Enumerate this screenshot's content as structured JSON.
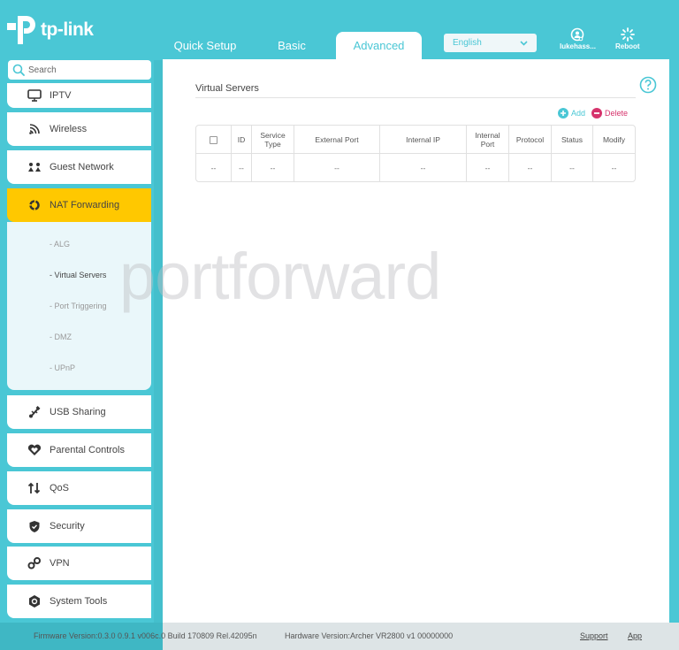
{
  "brand": {
    "name": "tp-link",
    "accent": "#4ac7d5",
    "highlight": "#ffc800",
    "danger": "#d6336c"
  },
  "header": {
    "tabs": [
      {
        "label": "Quick Setup",
        "active": false
      },
      {
        "label": "Basic",
        "active": false
      },
      {
        "label": "Advanced",
        "active": true
      }
    ],
    "language": {
      "selected": "English"
    },
    "user": {
      "label": "lukehass...",
      "icon": "user-icon"
    },
    "reboot": {
      "label": "Reboot",
      "icon": "reboot-icon"
    }
  },
  "sidebar": {
    "search_placeholder": "Search",
    "items": [
      {
        "label": "IPTV",
        "icon": "tv-icon"
      },
      {
        "label": "Wireless",
        "icon": "wireless-icon"
      },
      {
        "label": "Guest Network",
        "icon": "guest-network-icon"
      },
      {
        "label": "NAT Forwarding",
        "icon": "nat-forwarding-icon",
        "active": true
      },
      {
        "label": "USB Sharing",
        "icon": "usb-icon"
      },
      {
        "label": "Parental Controls",
        "icon": "heart-icon"
      },
      {
        "label": "QoS",
        "icon": "qos-arrows-icon"
      },
      {
        "label": "Security",
        "icon": "shield-icon"
      },
      {
        "label": "VPN",
        "icon": "vpn-link-icon"
      },
      {
        "label": "System Tools",
        "icon": "gear-icon"
      }
    ],
    "subitems": [
      {
        "label": "- ALG"
      },
      {
        "label": "- Virtual Servers",
        "active": true
      },
      {
        "label": "- Port Triggering"
      },
      {
        "label": "- DMZ"
      },
      {
        "label": "- UPnP"
      }
    ]
  },
  "main": {
    "title": "Virtual Servers",
    "add_label": "Add",
    "delete_label": "Delete",
    "table": {
      "headers": [
        "",
        "ID",
        "Service Type",
        "External Port",
        "Internal IP",
        "Internal Port",
        "Protocol",
        "Status",
        "Modify"
      ],
      "header_lines": [
        [
          ""
        ],
        [
          "ID"
        ],
        [
          "Service",
          "Type"
        ],
        [
          "External Port"
        ],
        [
          "Internal IP"
        ],
        [
          "Internal",
          "Port"
        ],
        [
          "Protocol"
        ],
        [
          "Status"
        ],
        [
          "Modify"
        ]
      ],
      "rows": [
        [
          "--",
          "--",
          "--",
          "--",
          "--",
          "--",
          "--",
          "--",
          "--"
        ]
      ]
    }
  },
  "watermark": "portforward",
  "footer": {
    "firmware": "Firmware Version:0.3.0 0.9.1 v006c.0 Build 170809 Rel.42095n",
    "hardware": "Hardware Version:Archer VR2800 v1 00000000",
    "support": "Support",
    "app": "App"
  }
}
